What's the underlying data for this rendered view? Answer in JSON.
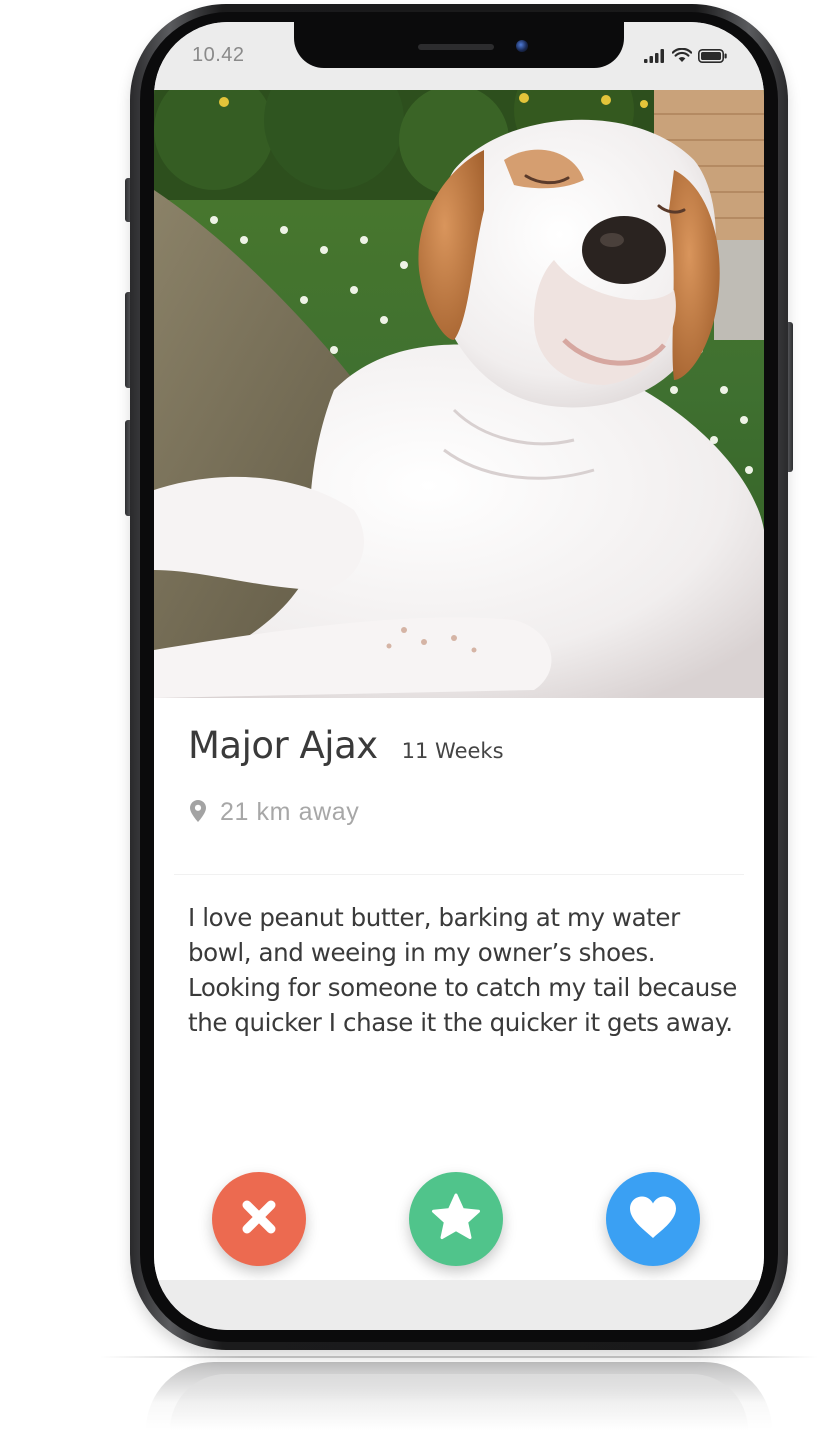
{
  "status_bar": {
    "time": "10.42"
  },
  "profile": {
    "name": "Major Ajax",
    "age": "11 Weeks",
    "distance": "21 km away",
    "bio": [
      "I love peanut butter, barking at my water bowl, and weeing in my owner’s shoes.",
      "Looking for someone to catch my tail because the quicker I chase it the quicker it gets away."
    ],
    "photo": {
      "subject": "white and tan puppy with eyes closed"
    }
  },
  "actions": [
    {
      "name": "nope",
      "icon": "close-icon",
      "color": "#ec6a50"
    },
    {
      "name": "super-like",
      "icon": "star-icon",
      "color": "#50c48b"
    },
    {
      "name": "like",
      "icon": "heart-icon",
      "color": "#3aa0f3"
    }
  ],
  "colors": {
    "screen_background": "#ececec",
    "card_background": "#ffffff",
    "text_primary": "#3a3a3a",
    "text_muted": "#a7a7a7"
  }
}
